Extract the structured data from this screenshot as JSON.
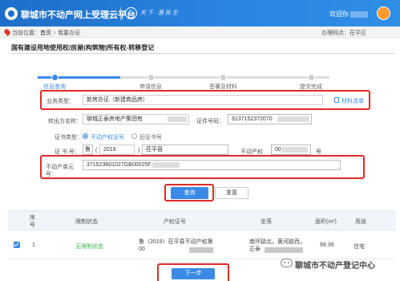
{
  "header": {
    "site_title": "聊城市不动产网上受理云平台",
    "slogan": "天 下 · 惠 民 生",
    "welcome": "欢迎你",
    "colors": {
      "primary": "#1d6ec8",
      "accent": "#3b8be6",
      "alert_frame": "#e02a2a",
      "status_green": "#3cb54a"
    }
  },
  "breadcrumb": {
    "prefix": "当前位置：",
    "home": "首页",
    "separator": ">",
    "current": "我要办证",
    "office_label": "办理网点：",
    "office_value": "茌平区"
  },
  "section_title": "国有建设用地使用权/房屋(构筑物)所有权-转移登记",
  "steps": [
    {
      "label": "信息查询",
      "active": true
    },
    {
      "label": "申请信息",
      "active": false
    },
    {
      "label": "签署及材料",
      "active": false
    },
    {
      "label": "提交完成",
      "active": false
    }
  ],
  "form": {
    "business_type_label": "业务类型：",
    "business_type_value": "新房办证（新建商品房）",
    "materials_link": "材料清单",
    "transferor_name_label": "转出方名称：",
    "transferor_name_value": "聊城正泰房地产集团有",
    "cert_no_label": "证件号码：",
    "cert_no_value": "9137152372070",
    "cert_type_label": "证书类型：",
    "cert_type_options": [
      {
        "label": "不动产权证号",
        "selected": true
      },
      {
        "label": "旧证书号",
        "selected": false
      }
    ],
    "cert_no_row_label": "证 书 号：",
    "cert_province": "鲁",
    "cert_year": "2019",
    "cert_region": "茌平县",
    "realty_cert_label": "不动产权",
    "realty_cert_value": "00",
    "realty_cert_suffix": "号",
    "unit_no_label": "不动产单元号：",
    "unit_no_value": "371523601027GB00025F"
  },
  "buttons": {
    "query": "查询",
    "reset": "重置",
    "next": "下一步"
  },
  "table": {
    "headers": [
      "序号",
      "限制状态",
      "产权证号",
      "坐落",
      "面积(m²)",
      "用途"
    ],
    "rows": [
      {
        "index": "1",
        "status": "无限制状态",
        "cert_no": "鲁（2019）茌平县不动产权第00",
        "location": "南环路北，黄河路西，正泰",
        "area": "99.39",
        "use": "住宅"
      }
    ]
  },
  "watermark": "聊城市不动产登记中心"
}
